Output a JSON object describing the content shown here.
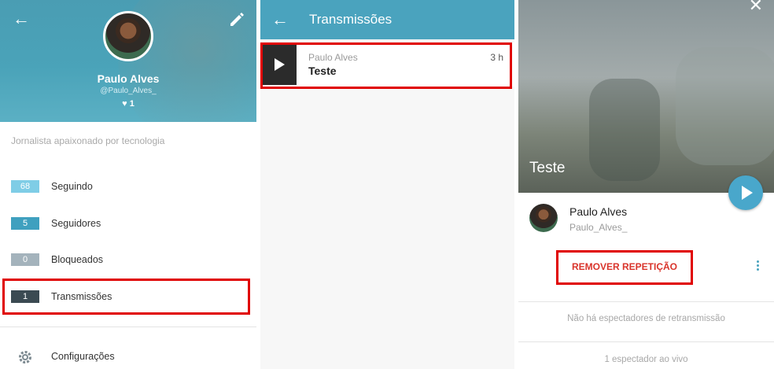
{
  "profile_panel": {
    "name": "Paulo Alves",
    "handle": "@Paulo_Alves_",
    "likes_count": "1",
    "bio": "Jornalista apaixonado por tecnologia",
    "stats": [
      {
        "count": "68",
        "label": "Seguindo",
        "color": "#7fcde6"
      },
      {
        "count": "5",
        "label": "Seguidores",
        "color": "#3fa0bf"
      },
      {
        "count": "0",
        "label": "Bloqueados",
        "color": "#a4b3bc"
      },
      {
        "count": "1",
        "label": "Transmissões",
        "color": "#3b4a52"
      }
    ],
    "settings_label": "Configurações",
    "icons": [
      "back-arrow-icon",
      "edit-pencil-icon",
      "heart-icon",
      "gear-icon"
    ]
  },
  "broadcasts_panel": {
    "title": "Transmissões",
    "items": [
      {
        "author": "Paulo Alves",
        "time": "3 h",
        "title": "Teste"
      }
    ]
  },
  "replay_panel": {
    "video_title": "Teste",
    "user_name": "Paulo Alves",
    "user_handle": "Paulo_Alves_",
    "remove_replay_label": "REMOVER REPETIÇÃO",
    "no_viewers_text": "Não há espectadores de retransmissão",
    "live_viewers_text": "1 espectador ao vivo"
  },
  "colors": {
    "header_blue": "#4aa3be",
    "highlight_red": "#e00000",
    "remove_red": "#d9342b",
    "fab_blue": "#49a7cb"
  }
}
